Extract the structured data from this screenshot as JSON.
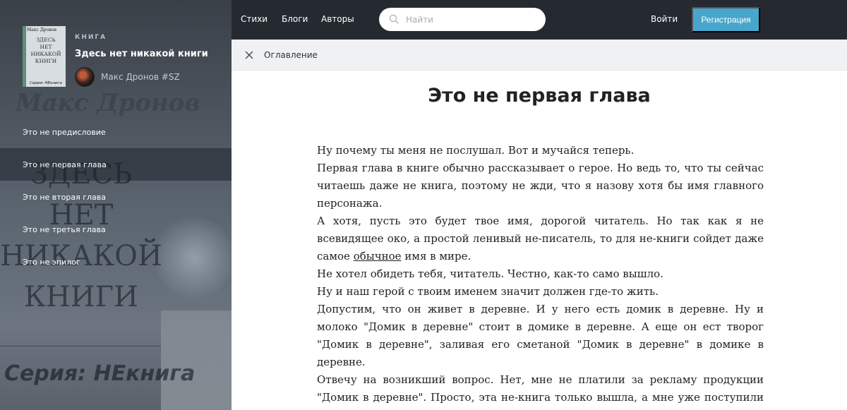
{
  "sidebar": {
    "background": {
      "author": "Макс Дронов",
      "title_lines": [
        "ЗДЕСЬ",
        "НЕТ",
        "НИКАКОЙ",
        "КНИГИ"
      ],
      "series": "Серия: НЕкнига"
    },
    "book": {
      "kind": "КНИГА",
      "title": "Здесь нет никакой книги",
      "author": "Макс Дронов #SZ",
      "cover": {
        "author": "Макс Дронов",
        "title_lines": [
          "ЗДЕСЬ",
          "НЕТ",
          "НИКАКОЙ",
          "КНИГИ"
        ],
        "series": "Серия: НЕкнига"
      }
    },
    "toc": [
      {
        "label": "Это не предисловие",
        "active": false
      },
      {
        "label": "Это не первая глава",
        "active": true
      },
      {
        "label": "Это не вторая глава",
        "active": false
      },
      {
        "label": "Это не третья глава",
        "active": false
      },
      {
        "label": "Это не эпилог",
        "active": false
      }
    ]
  },
  "topbar": {
    "nav": [
      "Стихи",
      "Блоги",
      "Авторы"
    ],
    "search_placeholder": "Найти",
    "login": "Войти",
    "register": "Регистрация"
  },
  "tocbar": {
    "label": "Оглавление",
    "icon": "close-icon"
  },
  "content": {
    "title": "Это не первая глава",
    "paragraphs": [
      "Ну почему ты меня не послушал. Вот и мучайся теперь.",
      "Первая глава в книге обычно рассказывает о герое. Но ведь то, что ты сейчас читаешь даже не книга, поэтому не жди, что я назову хотя бы имя главного персонажа.",
      "А хотя, пусть это будет твое имя, дорогой читатель. Но так как я не всевидящее око, а простой ленивый не-писатель, то для не-книги сойдет даже самое обычное имя в мире.",
      "Не хотел обидеть тебя, читатель. Честно, как-то само вышло.",
      "Ну и наш герой с твоим именем значит должен где-то жить.",
      "Допустим, что он живет в деревне. И у него есть домик в деревне. Ну и молоко \"Домик в деревне\" стоит в домике в деревне. А еще он ест творог \"Домик в деревне\", заливая его сметаной \"Домик в деревне\" в домике в деревне.",
      "Отвечу на возникший вопрос. Нет, мне не платили за рекламу продукции \"Домик в деревне\". Просто, эта не-книга только вышла, а мне уже поступили угрозы расправиться со мной, потому что я кого-то оскорбил."
    ],
    "underlined_word": "обычное"
  },
  "colors": {
    "topbar_bg": "#252a31",
    "register_bg": "#48a6cc",
    "tocbar_bg": "#f0f1f3",
    "text": "#222222"
  }
}
